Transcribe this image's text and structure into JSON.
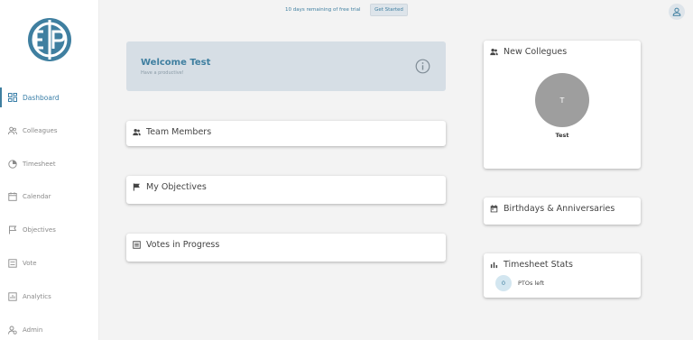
{
  "colors": {
    "accent": "#3f7fa0",
    "welcome_bg": "#d6dee5",
    "avatar_bg": "#9e9e9e"
  },
  "sidebar": {
    "logo_icon": "ep-logo-icon",
    "items": [
      {
        "label": "Dashboard",
        "icon": "grid-icon",
        "active": true
      },
      {
        "label": "Colleagues",
        "icon": "people-icon"
      },
      {
        "label": "Timesheet",
        "icon": "clock-icon"
      },
      {
        "label": "Calendar",
        "icon": "calendar-icon"
      },
      {
        "label": "Objectives",
        "icon": "flag-icon"
      },
      {
        "label": "Vote",
        "icon": "ballot-icon"
      },
      {
        "label": "Analytics",
        "icon": "analytics-icon"
      },
      {
        "label": "Admin",
        "icon": "admin-icon"
      }
    ]
  },
  "topbar": {
    "trial_text": "10 days remaining of free trial",
    "get_started_label": "Get Started",
    "user_icon": "user-icon"
  },
  "welcome": {
    "title": "Welcome Test",
    "subtitle": "Have a productive!",
    "icon": "info-icon"
  },
  "cards": {
    "team_members": {
      "title": "Team Members",
      "icon": "people-icon"
    },
    "my_objectives": {
      "title": "My Objectives",
      "icon": "flag-icon"
    },
    "votes_in_progress": {
      "title": "Votes in Progress",
      "icon": "ballot-icon"
    },
    "new_colleagues": {
      "title": "New Collegues",
      "icon": "people-icon",
      "colleague": {
        "initial": "T",
        "name": "Test"
      }
    },
    "birthdays": {
      "title": "Birthdays & Anniversaries",
      "icon": "calendar-icon"
    },
    "timesheet_stats": {
      "title": "Timesheet Stats",
      "icon": "bar-chart-icon",
      "pto_count": "0",
      "pto_label": "PTOs left"
    }
  }
}
